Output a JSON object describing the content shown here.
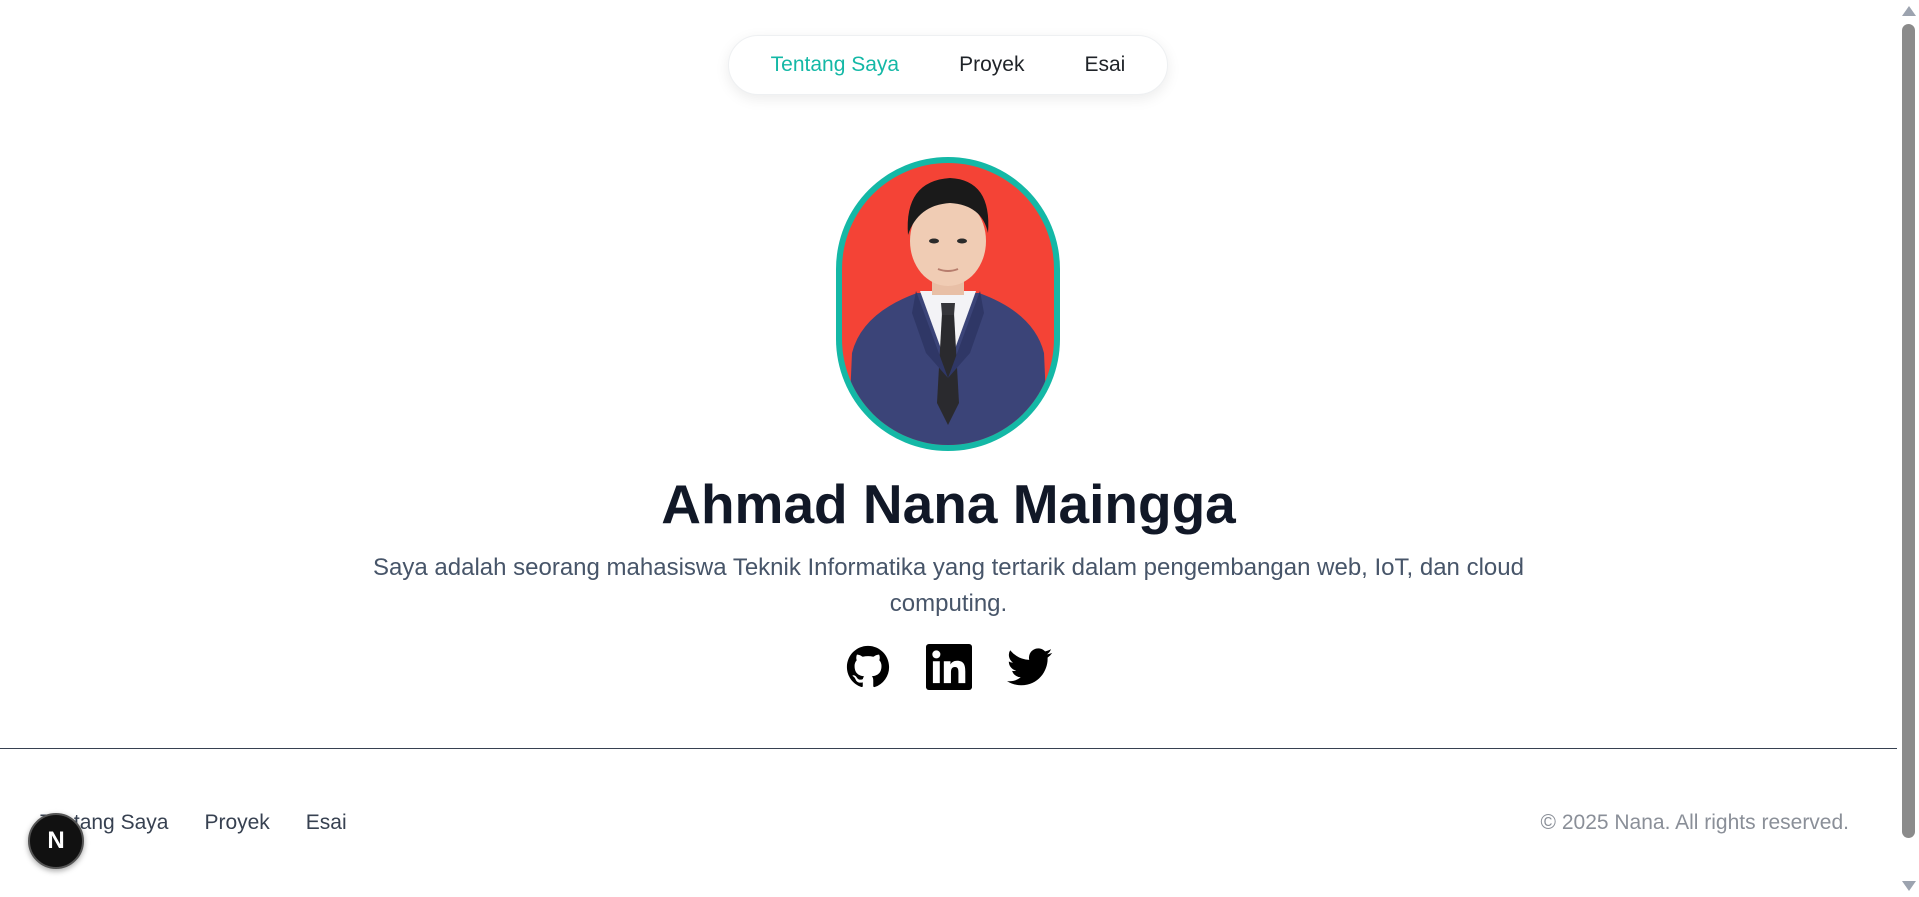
{
  "nav": {
    "items": [
      {
        "label": "Tentang Saya",
        "active": true
      },
      {
        "label": "Proyek",
        "active": false
      },
      {
        "label": "Esai",
        "active": false
      }
    ]
  },
  "profile": {
    "name": "Ahmad Nana Maingga",
    "bio": "Saya adalah seorang mahasiswa Teknik Informatika yang tertarik dalam pengembangan web, IoT, dan cloud computing."
  },
  "socials": [
    {
      "icon": "github-icon"
    },
    {
      "icon": "linkedin-icon"
    },
    {
      "icon": "twitter-icon"
    }
  ],
  "footer": {
    "nav": [
      "Tentang Saya",
      "Proyek",
      "Esai"
    ],
    "copyright": "© 2025 Nana. All rights reserved."
  },
  "dev_badge": {
    "letter": "N"
  },
  "colors": {
    "accent": "#14b8a6",
    "photo_background": "#f44336",
    "heading": "#111827"
  }
}
